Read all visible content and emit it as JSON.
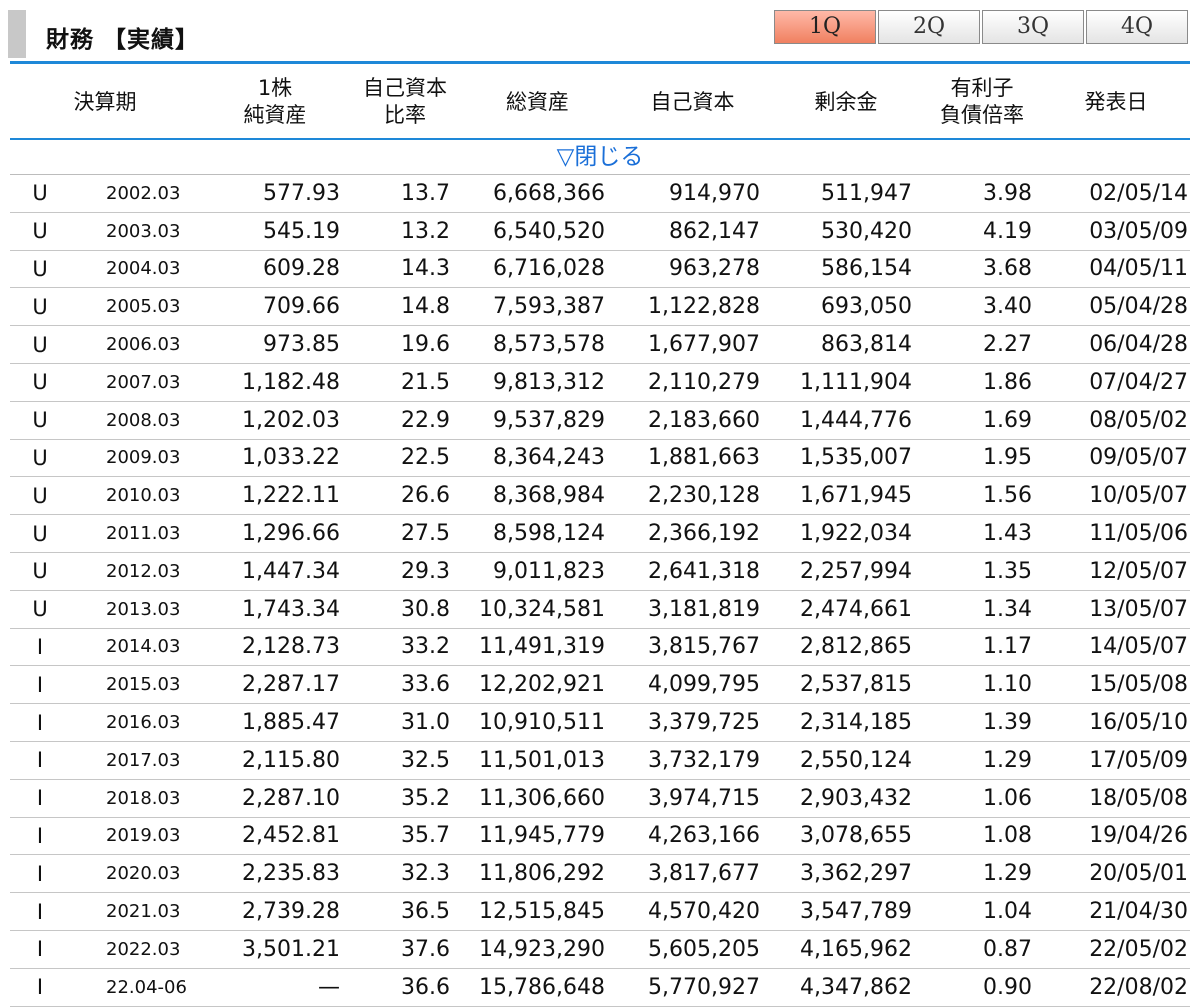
{
  "header": {
    "title": "財務 【実績】",
    "quarter_tabs": [
      "1Q",
      "2Q",
      "3Q",
      "4Q"
    ],
    "active_tab": "1Q"
  },
  "table": {
    "columns": [
      "決算期",
      "1株\n純資産",
      "自己資本\n比率",
      "総資産",
      "自己資本",
      "剰余金",
      "有利子\n負債倍率",
      "発表日"
    ],
    "toggle_label": "▽閉じる",
    "rows": [
      [
        "U",
        "2002.03",
        "577.93",
        "13.7",
        "6,668,366",
        "914,970",
        "511,947",
        "3.98",
        "02/05/14"
      ],
      [
        "U",
        "2003.03",
        "545.19",
        "13.2",
        "6,540,520",
        "862,147",
        "530,420",
        "4.19",
        "03/05/09"
      ],
      [
        "U",
        "2004.03",
        "609.28",
        "14.3",
        "6,716,028",
        "963,278",
        "586,154",
        "3.68",
        "04/05/11"
      ],
      [
        "U",
        "2005.03",
        "709.66",
        "14.8",
        "7,593,387",
        "1,122,828",
        "693,050",
        "3.40",
        "05/04/28"
      ],
      [
        "U",
        "2006.03",
        "973.85",
        "19.6",
        "8,573,578",
        "1,677,907",
        "863,814",
        "2.27",
        "06/04/28"
      ],
      [
        "U",
        "2007.03",
        "1,182.48",
        "21.5",
        "9,813,312",
        "2,110,279",
        "1,111,904",
        "1.86",
        "07/04/27"
      ],
      [
        "U",
        "2008.03",
        "1,202.03",
        "22.9",
        "9,537,829",
        "2,183,660",
        "1,444,776",
        "1.69",
        "08/05/02"
      ],
      [
        "U",
        "2009.03",
        "1,033.22",
        "22.5",
        "8,364,243",
        "1,881,663",
        "1,535,007",
        "1.95",
        "09/05/07"
      ],
      [
        "U",
        "2010.03",
        "1,222.11",
        "26.6",
        "8,368,984",
        "2,230,128",
        "1,671,945",
        "1.56",
        "10/05/07"
      ],
      [
        "U",
        "2011.03",
        "1,296.66",
        "27.5",
        "8,598,124",
        "2,366,192",
        "1,922,034",
        "1.43",
        "11/05/06"
      ],
      [
        "U",
        "2012.03",
        "1,447.34",
        "29.3",
        "9,011,823",
        "2,641,318",
        "2,257,994",
        "1.35",
        "12/05/07"
      ],
      [
        "U",
        "2013.03",
        "1,743.34",
        "30.8",
        "10,324,581",
        "3,181,819",
        "2,474,661",
        "1.34",
        "13/05/07"
      ],
      [
        "I",
        "2014.03",
        "2,128.73",
        "33.2",
        "11,491,319",
        "3,815,767",
        "2,812,865",
        "1.17",
        "14/05/07"
      ],
      [
        "I",
        "2015.03",
        "2,287.17",
        "33.6",
        "12,202,921",
        "4,099,795",
        "2,537,815",
        "1.10",
        "15/05/08"
      ],
      [
        "I",
        "2016.03",
        "1,885.47",
        "31.0",
        "10,910,511",
        "3,379,725",
        "2,314,185",
        "1.39",
        "16/05/10"
      ],
      [
        "I",
        "2017.03",
        "2,115.80",
        "32.5",
        "11,501,013",
        "3,732,179",
        "2,550,124",
        "1.29",
        "17/05/09"
      ],
      [
        "I",
        "2018.03",
        "2,287.10",
        "35.2",
        "11,306,660",
        "3,974,715",
        "2,903,432",
        "1.06",
        "18/05/08"
      ],
      [
        "I",
        "2019.03",
        "2,452.81",
        "35.7",
        "11,945,779",
        "4,263,166",
        "3,078,655",
        "1.08",
        "19/04/26"
      ],
      [
        "I",
        "2020.03",
        "2,235.83",
        "32.3",
        "11,806,292",
        "3,817,677",
        "3,362,297",
        "1.29",
        "20/05/01"
      ],
      [
        "I",
        "2021.03",
        "2,739.28",
        "36.5",
        "12,515,845",
        "4,570,420",
        "3,547,789",
        "1.04",
        "21/04/30"
      ],
      [
        "I",
        "2022.03",
        "3,501.21",
        "37.6",
        "14,923,290",
        "5,605,205",
        "4,165,962",
        "0.87",
        "22/05/02"
      ],
      [
        "I",
        "22.04-06",
        "—",
        "36.6",
        "15,786,648",
        "5,770,927",
        "4,347,862",
        "0.90",
        "22/08/02"
      ]
    ]
  }
}
